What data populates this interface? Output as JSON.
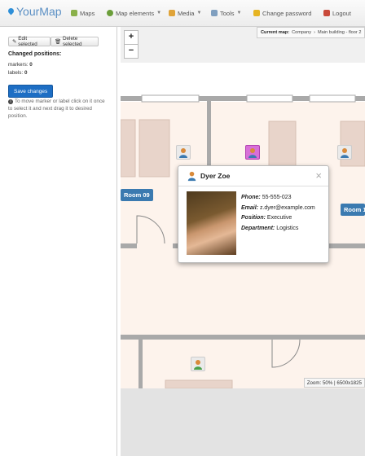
{
  "app": {
    "brand": "YourMap"
  },
  "nav": {
    "maps": "Maps",
    "map_elements": "Map elements",
    "media": "Media",
    "tools": "Tools",
    "change_password": "Change password",
    "logout": "Logout"
  },
  "sidebar": {
    "edit_selected": "Edit selected",
    "delete_selected": "Delete selected",
    "changed_title": "Changed positions:",
    "markers_label": "markers:",
    "markers_count": "0",
    "labels_label": "labels:",
    "labels_count": "0",
    "save_changes": "Save changes",
    "hint": "To move marker or label click on it once to select it and next drag it to desired position."
  },
  "map": {
    "zoom_in": "+",
    "zoom_out": "−",
    "current_map_label": "Current map:",
    "crumb_1": "Company",
    "crumb_2": "Main building - floor 2",
    "room_09": "Room 09",
    "room_right": "Room 1",
    "zoom_status": "Zoom: 50% | 6500x1825"
  },
  "popup": {
    "name": "Dyer Zoe",
    "phone_label": "Phone:",
    "phone": "55-555-023",
    "email_label": "Email:",
    "email": "z.dyer@example.com",
    "position_label": "Position:",
    "position": "Executive",
    "department_label": "Department:",
    "department": "Logistics"
  },
  "colors": {
    "accent": "#1d6ec4",
    "room_label": "#3b7ab0",
    "floor": "#fdf3ec",
    "wall": "#a9a9a9",
    "furniture": "#e8d4ca",
    "selected_marker": "#d86fd8"
  },
  "icons": [
    "map-pin-icon",
    "maps-icon",
    "map-elements-icon",
    "media-icon",
    "tools-icon",
    "lock-icon",
    "logout-icon",
    "pencil-icon",
    "trash-icon",
    "info-icon",
    "person-icon",
    "close-icon",
    "chevron-down-icon"
  ]
}
